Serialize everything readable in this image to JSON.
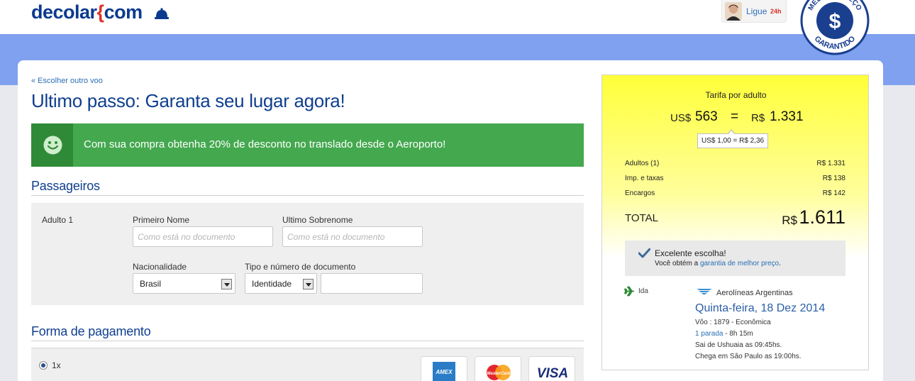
{
  "header": {
    "logo_text": "decolar",
    "logo_brace": "{",
    "logo_suffix": "com",
    "ligue_label": "Ligue",
    "ligue_hours": "24h",
    "seal_top": "MELHOR PREÇO",
    "seal_bottom": "GARANTIDO",
    "seal_symbol": "$"
  },
  "main": {
    "back_link": "« Escolher outro voo",
    "title": "Ultimo passo: Garanta seu lugar agora!",
    "promo_text": "Com sua compra obtenha 20% de desconto no translado desde o Aeroporto!"
  },
  "passengers": {
    "section_title": "Passageiros",
    "passenger_label": "Adulto 1",
    "first_name_label": "Primeiro Nome",
    "first_name_placeholder": "Como está no documento",
    "last_name_label": "Ultimo Sobrenome",
    "last_name_placeholder": "Como está no documento",
    "nationality_label": "Nacionalidade",
    "nationality_value": "Brasil",
    "document_label": "Tipo e número de documento",
    "document_type_value": "Identidade",
    "document_number_value": ""
  },
  "payment": {
    "section_title": "Forma de pagamento",
    "option_label": "1x",
    "cards": [
      "AMEX",
      "MasterCard",
      "VISA"
    ]
  },
  "summary": {
    "tarifa_label": "Tarifa por adulto",
    "usd_currency": "US$",
    "usd_value": "563",
    "equals": "=",
    "brl_currency": "R$",
    "brl_value": "1.331",
    "rate_tooltip": "US$ 1,00 = R$ 2,36",
    "rows": [
      {
        "label": "Adultos (1)",
        "value": "R$ 1.331"
      },
      {
        "label": "Imp. e taxas",
        "value": "R$ 138"
      },
      {
        "label": "Encargos",
        "value": "R$ 142"
      }
    ],
    "total_label": "TOTAL",
    "total_currency": "R$",
    "total_value": "1.611",
    "excellent_title": "Excelente escolha!",
    "excellent_prefix": "Você obtém a",
    "excellent_link": "garantia de melhor preço",
    "excellent_suffix": "."
  },
  "flight": {
    "direction": "Ida",
    "airline": "Aerolíneas Argentinas",
    "date": "Quinta-feira, 18 Dez 2014",
    "flight_info": "Vôo : 1879  -  Econômica",
    "stops_link": "1 parada",
    "duration": " -  8h 15m",
    "departure": "Sai de Ushuaia as 09:45hs.",
    "arrival": "Chega em São Paulo as 19:00hs."
  },
  "colors": {
    "brand_blue": "#0f3f8f",
    "accent_red": "#e0322a",
    "promo_green": "#44a84f",
    "link_blue": "#2a6fb5",
    "band_blue": "#7fa1ef",
    "summary_yellow": "#ffff3a"
  }
}
